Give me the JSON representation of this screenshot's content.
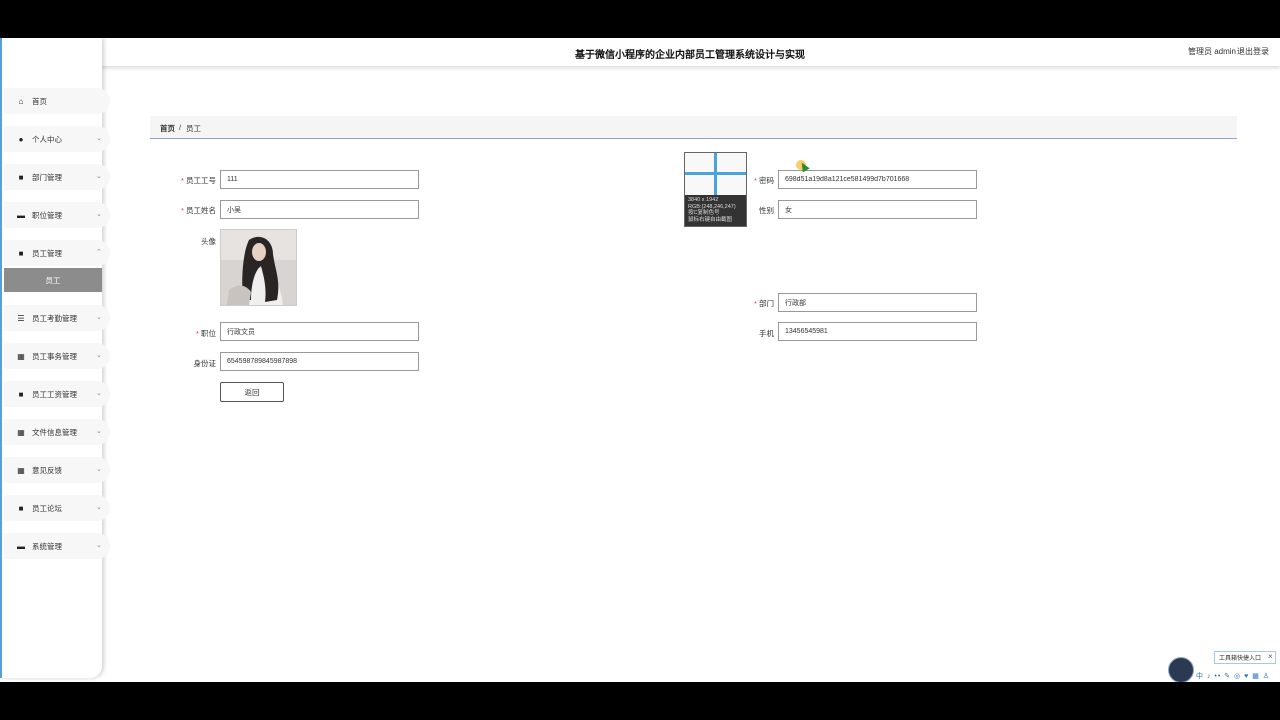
{
  "header": {
    "title": "基于微信小程序的企业内部员工管理系统设计与实现",
    "user": "管理员 admin",
    "logout": "退出登录"
  },
  "sidebar": {
    "items": [
      {
        "label": "首页",
        "icon": "home-icon",
        "glyph": "⌂"
      },
      {
        "label": "个人中心",
        "icon": "user-icon",
        "glyph": "●"
      },
      {
        "label": "部门管理",
        "icon": "department-icon",
        "glyph": "■"
      },
      {
        "label": "职位管理",
        "icon": "position-icon",
        "glyph": "▬"
      },
      {
        "label": "员工管理",
        "icon": "employee-icon",
        "glyph": "■"
      },
      {
        "label": "员工考勤管理",
        "icon": "list-icon",
        "glyph": "☰"
      },
      {
        "label": "员工事务管理",
        "icon": "grid-icon",
        "glyph": "▦"
      },
      {
        "label": "员工工资管理",
        "icon": "salary-icon",
        "glyph": "■"
      },
      {
        "label": "文件信息管理",
        "icon": "grid-icon",
        "glyph": "▦"
      },
      {
        "label": "意见反馈",
        "icon": "grid-icon",
        "glyph": "▦"
      },
      {
        "label": "员工论坛",
        "icon": "forum-icon",
        "glyph": "■"
      },
      {
        "label": "系统管理",
        "icon": "monitor-icon",
        "glyph": "▬"
      }
    ],
    "sub_item": "员工"
  },
  "breadcrumb": {
    "home": "首页",
    "sep": "/",
    "current": "员工"
  },
  "form": {
    "employee_no_label": "员工工号",
    "employee_no": "111",
    "name_label": "员工姓名",
    "name": "小吴",
    "avatar_label": "头像",
    "position_label": "职位",
    "position": "行政文员",
    "id_card_label": "身份证",
    "id_card": "654598789845987898",
    "password_label": "密码",
    "password": "698d51a19d8a121ce581499d7b701668",
    "gender_label": "性别",
    "gender": "女",
    "department_label": "部门",
    "department": "行政部",
    "phone_label": "手机",
    "phone": "13456545981",
    "back_button": "返回"
  },
  "color_picker": {
    "size": "3840 x 1942",
    "rgb": "RGB:(248,246,247)",
    "hint1": "按C复制色号",
    "hint2": "鼠标右键自由截图"
  },
  "taskbar": {
    "entry": "工具箱快捷入口",
    "close": "×",
    "icons": "中 ♪ •• ✎ ◎ ♥ ▦ ♙"
  }
}
